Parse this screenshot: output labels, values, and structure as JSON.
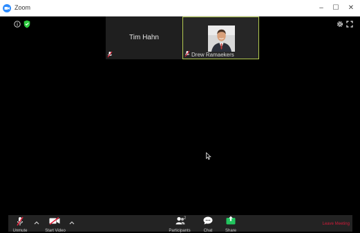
{
  "window": {
    "title": "Zoom",
    "controls": {
      "minimize": "–",
      "maximize": "☐",
      "close": "✕"
    }
  },
  "participants": [
    {
      "name": "Tim Hahn",
      "video": false,
      "muted": true
    },
    {
      "name": "Drew Ramaekers",
      "video": true,
      "muted": true,
      "active_speaker": true
    }
  ],
  "toolbar": {
    "unmute_label": "Unmute",
    "start_video_label": "Start Video",
    "participants_label": "Participants",
    "participants_count": "2",
    "chat_label": "Chat",
    "share_label": "Share",
    "leave_label": "Leave Meeting"
  },
  "colors": {
    "accent_speaker_border": "#b5cc52",
    "leave": "#d11b3a",
    "share_green": "#22c55e",
    "security_green": "#2ecc40"
  },
  "icons": [
    "info-icon",
    "shield-icon",
    "gear-icon",
    "fullscreen-icon",
    "microphone-muted-icon",
    "video-off-icon",
    "participants-icon",
    "chat-icon",
    "share-screen-icon",
    "cursor-icon"
  ]
}
